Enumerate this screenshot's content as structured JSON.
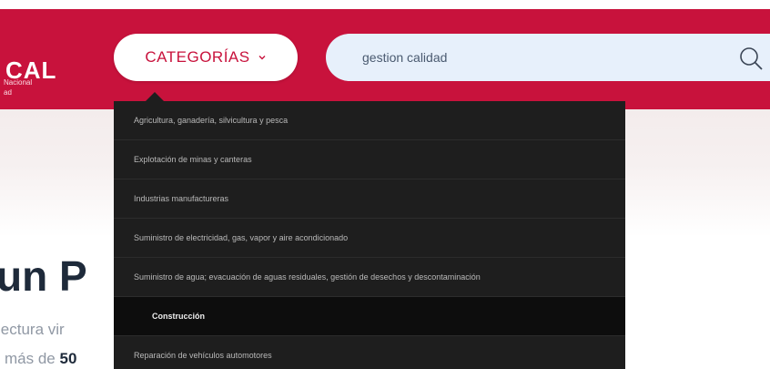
{
  "logo": {
    "name": "CAL",
    "line1": "Nacional",
    "line2": "ad"
  },
  "header": {
    "categories_label": "CATEGORÍAS"
  },
  "search": {
    "value": "gestion calidad"
  },
  "hero": {
    "title": "un P",
    "line1": "lectura vir",
    "line2_prefix": "más de",
    "line2_number": "50"
  },
  "menu": {
    "items": [
      "Agricultura, ganadería, silvicultura y pesca",
      "Explotación de minas y canteras",
      "Industrias manufactureras",
      "Suministro de electricidad, gas, vapor y aire acondicionado",
      "Suministro de agua; evacuación de aguas residuales, gestión de desechos y descontaminación",
      "Construcción",
      "Reparación de vehículos automotores"
    ],
    "active_index": 5
  },
  "colors": {
    "brand": "#c8123c",
    "menu_bg": "#1e1e1e",
    "search_bg": "#e7f0fb"
  }
}
